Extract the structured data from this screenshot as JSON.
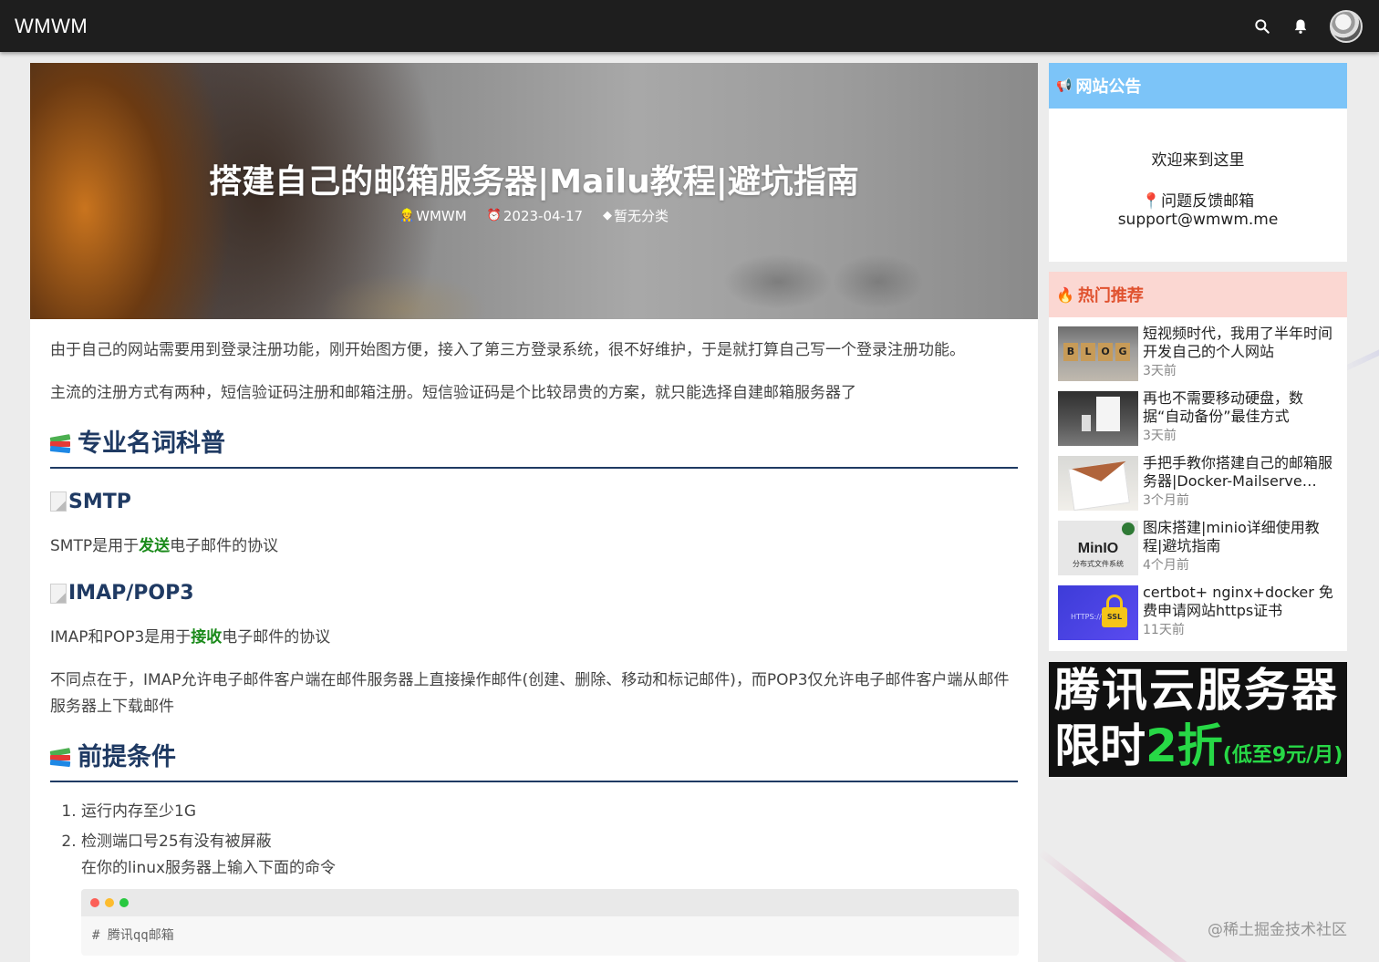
{
  "header": {
    "brand": "WMWM",
    "icons": [
      "search-icon",
      "bell-icon",
      "avatar"
    ]
  },
  "article": {
    "title": "搭建自己的邮箱服务器|Mailu教程|避坑指南",
    "author": "WMWM",
    "date": "2023-04-17",
    "category": "暂无分类",
    "intro1": "由于自己的网站需要用到登录注册功能，刚开始图方便，接入了第三方登录系统，很不好维护，于是就打算自己写一个登录注册功能。",
    "intro2": "主流的注册方式有两种，短信验证码注册和邮箱注册。短信验证码是个比较昂贵的方案，就只能选择自建邮箱服务器了",
    "section1": "专业名词科普",
    "smtp_heading": "SMTP",
    "smtp_pre": "SMTP是用于",
    "smtp_hl": "发送",
    "smtp_post": "电子邮件的协议",
    "imap_heading": "IMAP/POP3",
    "imap_pre": "IMAP和POP3是用于",
    "imap_hl": "接收",
    "imap_post": "电子邮件的协议",
    "diff": "不同点在于，IMAP允许电子邮件客户端在邮件服务器上直接操作邮件(创建、删除、移动和标记邮件)，而POP3仅允许电子邮件客户端从邮件服务器上下载邮件",
    "section2": "前提条件",
    "step1": "运行内存至少1G",
    "step2": "检测端口号25有没有被屏蔽",
    "step2_sub": "在你的linux服务器上输入下面的命令",
    "code_comment": "# 腾讯qq邮箱"
  },
  "sidebar": {
    "notice_title": "网站公告",
    "welcome": "欢迎来到这里",
    "feedback": "问题反馈邮箱",
    "email": "support@wmwm.me",
    "hot_title": "热门推荐",
    "hot_items": [
      {
        "title": "短视频时代，我用了半年时间开发自己的个人网站",
        "time": "3天前"
      },
      {
        "title": "再也不需要移动硬盘，数据“自动备份”最佳方式",
        "time": "3天前"
      },
      {
        "title": "手把手教你搭建自己的邮箱服务器|Docker-Mailserve…",
        "time": "3个月前"
      },
      {
        "title": "图床搭建|minio详细使用教程|避坑指南",
        "time": "4个月前"
      },
      {
        "title": "certbot+ nginx+docker 免费申请网站https证书",
        "time": "11天前"
      }
    ],
    "thumb_labels": {
      "blog": [
        "B",
        "L",
        "O",
        "G"
      ],
      "minio": "MinIO",
      "minio_sub": "分布式文件系统",
      "https": "HTTPS://",
      "ssl": "SSL"
    },
    "ad_line1": "腾讯云服务器",
    "ad_line2_a": "限时",
    "ad_line2_b": "2折",
    "ad_line2_c": "(低至9元/月)"
  },
  "watermark": "@稀土掘金技术社区",
  "colors": {
    "topbar": "#1e1e1e",
    "heading": "#1f3a63",
    "highlight": "#1a8a1a",
    "notice_head": "#7cc4f8",
    "hot_head_bg": "#fbd7d2",
    "hot_head_text": "#e0522f"
  }
}
